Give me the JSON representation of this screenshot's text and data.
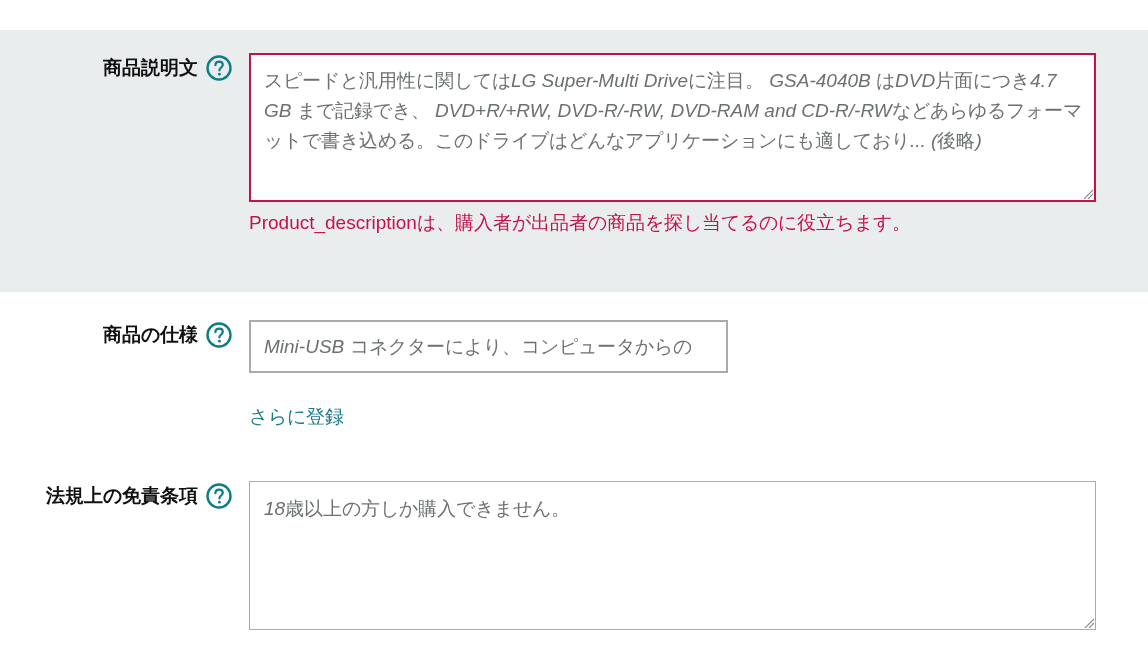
{
  "fields": [
    {
      "kind": "textarea",
      "label": "商品説明文",
      "help_icon": true,
      "invalid": true,
      "placeholder": "スピードと汎用性に関してはLG Super-Multi Driveに注目。 GSA-4040B はDVD片面につき4.7 GB まで記録でき、 DVD+R/+RW, DVD-R/-RW, DVD-RAM and CD-R/-RWなどあらゆるフォーマットで書き込める。このドライブはどんなアプリケーションにも適しており... (後略)",
      "error_message": "Product_descriptionは、購入者が出品者の商品を探し当てるのに役立ちます。"
    },
    {
      "kind": "input",
      "label": "商品の仕様",
      "help_icon": true,
      "invalid": false,
      "placeholder": "Mini-USB コネクターにより、コンピュータからの",
      "link": "さらに登録"
    },
    {
      "kind": "textarea",
      "label": "法規上の免責条項",
      "help_icon": true,
      "invalid": false,
      "placeholder": "18歳以上の方しか購入できません。"
    }
  ]
}
